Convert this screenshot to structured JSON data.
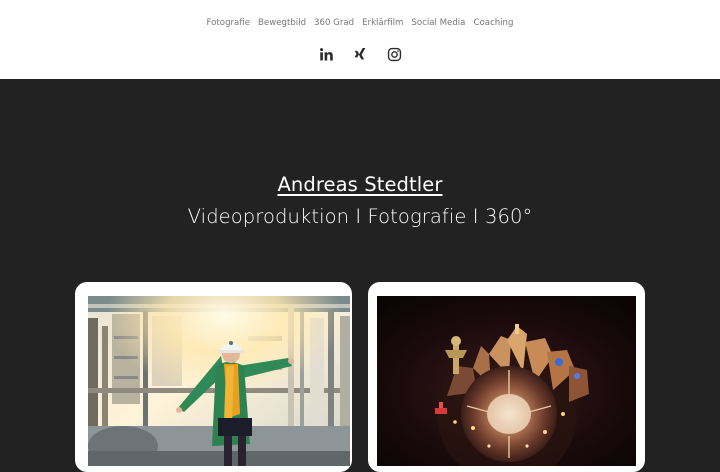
{
  "nav": {
    "items": [
      {
        "label": "Fotografie"
      },
      {
        "label": "Bewegtbild"
      },
      {
        "label": "360 Grad"
      },
      {
        "label": "Erklärfilm"
      },
      {
        "label": "Social Media"
      },
      {
        "label": "Coaching"
      }
    ]
  },
  "social": {
    "icons": [
      "linkedin-icon",
      "xing-icon",
      "instagram-icon"
    ]
  },
  "hero": {
    "name": "Andreas Stedtler",
    "tagline": "Videoproduktion I Fotografie I 360°"
  },
  "colors": {
    "background_dark": "#222222",
    "header_bg": "#ffffff",
    "nav_text": "#777777",
    "hero_text": "#ffffff"
  }
}
